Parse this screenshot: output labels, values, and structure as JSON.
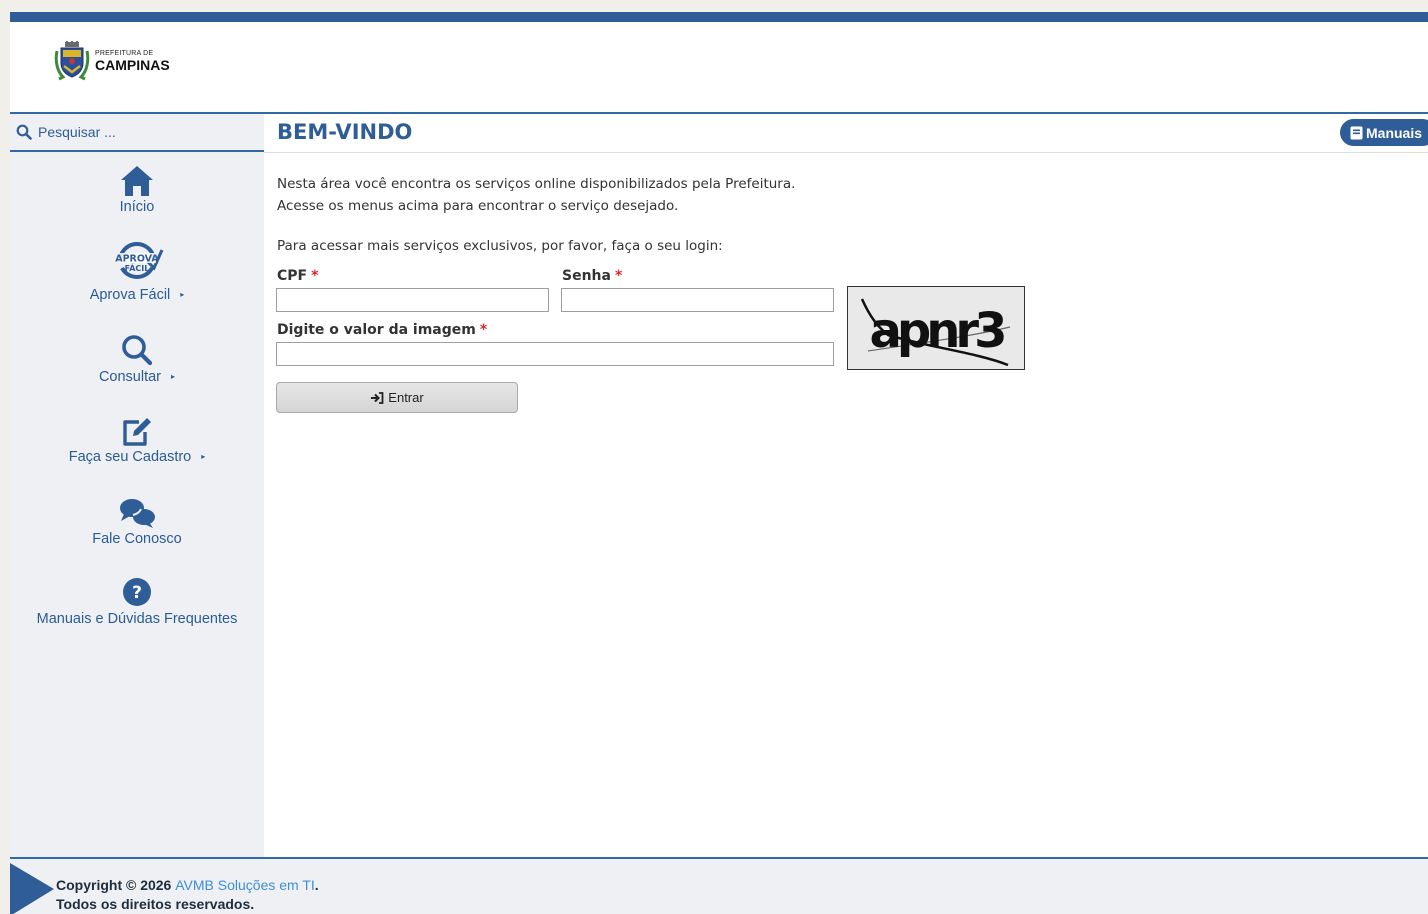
{
  "header": {
    "logo_small": "PREFEITURA DE",
    "logo_big": "CAMPINAS"
  },
  "sidebar": {
    "search_placeholder": "Pesquisar ...",
    "items": [
      {
        "label": "Início",
        "icon": "home-icon"
      },
      {
        "label": "Aprova Fácil",
        "icon": "aprova-facil-icon",
        "submenu": true
      },
      {
        "label": "Consultar",
        "icon": "search-icon",
        "submenu": true
      },
      {
        "label": "Faça seu Cadastro",
        "icon": "edit-icon",
        "submenu": true
      },
      {
        "label": "Fale Conosco",
        "icon": "chat-icon"
      },
      {
        "label": "Manuais e Dúvidas Frequentes",
        "icon": "question-icon"
      }
    ],
    "caret": "▸",
    "aprova_badge_top": "APROVA",
    "aprova_badge_bottom": "FÁCIL"
  },
  "main": {
    "title": "BEM-VINDO",
    "manuais_button": "Manuais",
    "intro_line1": "Nesta área você encontra os serviços online disponibilizados pela Prefeitura.",
    "intro_line2": "Acesse os menus acima para encontrar o serviço desejado.",
    "login_note": "Para acessar mais serviços exclusivos, por favor, faça o seu login:",
    "cpf_label": "CPF",
    "senha_label": "Senha",
    "captcha_label": "Digite o valor da imagem",
    "required_mark": "*",
    "cpf_value": "",
    "senha_value": "",
    "captcha_value": "",
    "captcha_text": "apnr3",
    "entrar_button": "Entrar"
  },
  "footer": {
    "copyright": "Copyright © 2026",
    "company": "AVMB Soluções em TI",
    "period": ".",
    "rights": "Todos os direitos reservados."
  },
  "colors": {
    "primary": "#2f5d98",
    "required": "#d9282e",
    "link": "#3d8fd6"
  }
}
